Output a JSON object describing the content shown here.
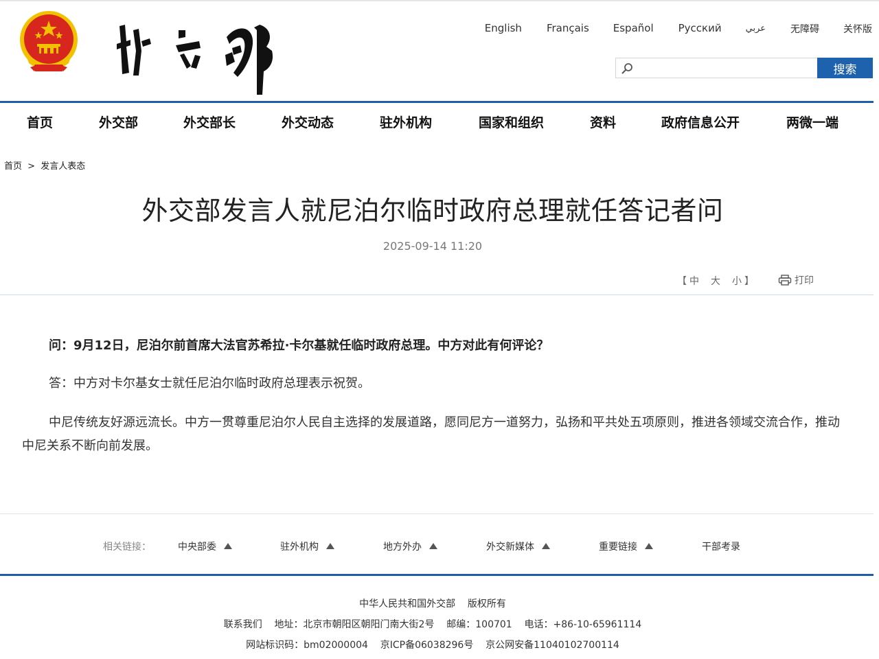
{
  "header": {
    "languages": [
      "English",
      "Français",
      "Español",
      "Русский",
      "عربي",
      "无障碍",
      "关怀版"
    ],
    "search": {
      "placeholder": "",
      "button_label": "搜索"
    }
  },
  "nav": {
    "items": [
      "首页",
      "外交部",
      "外交部长",
      "外交动态",
      "驻外机构",
      "国家和组织",
      "资料",
      "政府信息公开",
      "两微一端"
    ]
  },
  "breadcrumb": {
    "home": "首页",
    "separator": ">",
    "current": "发言人表态"
  },
  "article": {
    "title": "外交部发言人就尼泊尔临时政府总理就任答记者问",
    "date": "2025-09-14 11:20",
    "font_sizes": {
      "open": "【",
      "medium": "中",
      "large": "大",
      "small": "小",
      "close": "】"
    },
    "print_label": "打印",
    "question": "问：9月12日，尼泊尔前首席大法官苏希拉·卡尔基就任临时政府总理。中方对此有何评论？",
    "answer": "答：中方对卡尔基女士就任尼泊尔临时政府总理表示祝贺。",
    "paragraph": "中尼传统友好源远流长。中方一贯尊重尼泊尔人民自主选择的发展道路，愿同尼方一道努力，弘扬和平共处五项原则，推进各领域交流合作，推动中尼关系不断向前发展。"
  },
  "related_links": {
    "label": "相关链接：",
    "items": [
      "中央部委",
      "驻外机构",
      "地方外办",
      "外交新媒体",
      "重要链接",
      "干部考录"
    ]
  },
  "footer": {
    "line1": "中华人民共和国外交部    版权所有",
    "line2": "联系我们    地址：北京市朝阳区朝阳门南大街2号    邮编：100701    电话：+86-10-65961114",
    "line3": "网站标识码：bm02000004    京ICP备06038296号    京公网安备11040102700114"
  },
  "colors": {
    "accent": "#1e62ad",
    "emblem_red": "#d7261e",
    "emblem_gold": "#f2c100"
  }
}
